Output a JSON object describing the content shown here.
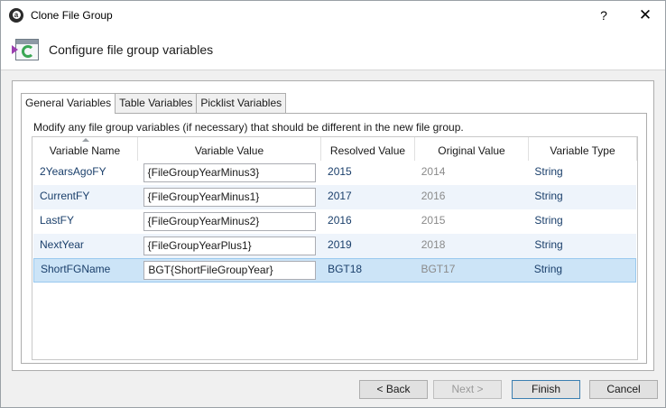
{
  "window": {
    "title": "Clone File Group",
    "help_label": "?",
    "close_label": "✕"
  },
  "header": {
    "text": "Configure file group variables"
  },
  "tabs": [
    {
      "label": "General Variables",
      "active": true
    },
    {
      "label": "Table Variables",
      "active": false
    },
    {
      "label": "Picklist Variables",
      "active": false
    }
  ],
  "instruction": "Modify any file group variables (if necessary) that should be different in the new file group.",
  "grid": {
    "columns": [
      "Variable Name",
      "Variable Value",
      "Resolved Value",
      "Original Value",
      "Variable Type"
    ],
    "rows": [
      {
        "name": "2YearsAgoFY",
        "value": "{FileGroupYearMinus3}",
        "resolved": "2015",
        "original": "2014",
        "type": "String"
      },
      {
        "name": "CurrentFY",
        "value": "{FileGroupYearMinus1}",
        "resolved": "2017",
        "original": "2016",
        "type": "String"
      },
      {
        "name": "LastFY",
        "value": "{FileGroupYearMinus2}",
        "resolved": "2016",
        "original": "2015",
        "type": "String"
      },
      {
        "name": "NextYear",
        "value": "{FileGroupYearPlus1}",
        "resolved": "2019",
        "original": "2018",
        "type": "String"
      },
      {
        "name": "ShortFGName",
        "value": "BGT{ShortFileGroupYear}",
        "resolved": "BGT18",
        "original": "BGT17",
        "type": "String"
      }
    ]
  },
  "buttons": {
    "back": "< Back",
    "next": "Next >",
    "finish": "Finish",
    "cancel": "Cancel"
  },
  "colors": {
    "selected_row": "#cce4f7",
    "alt_row": "#eef4fb",
    "header_icon_arrow": "#9b3fb0",
    "header_icon_cycle": "#3aa655"
  }
}
